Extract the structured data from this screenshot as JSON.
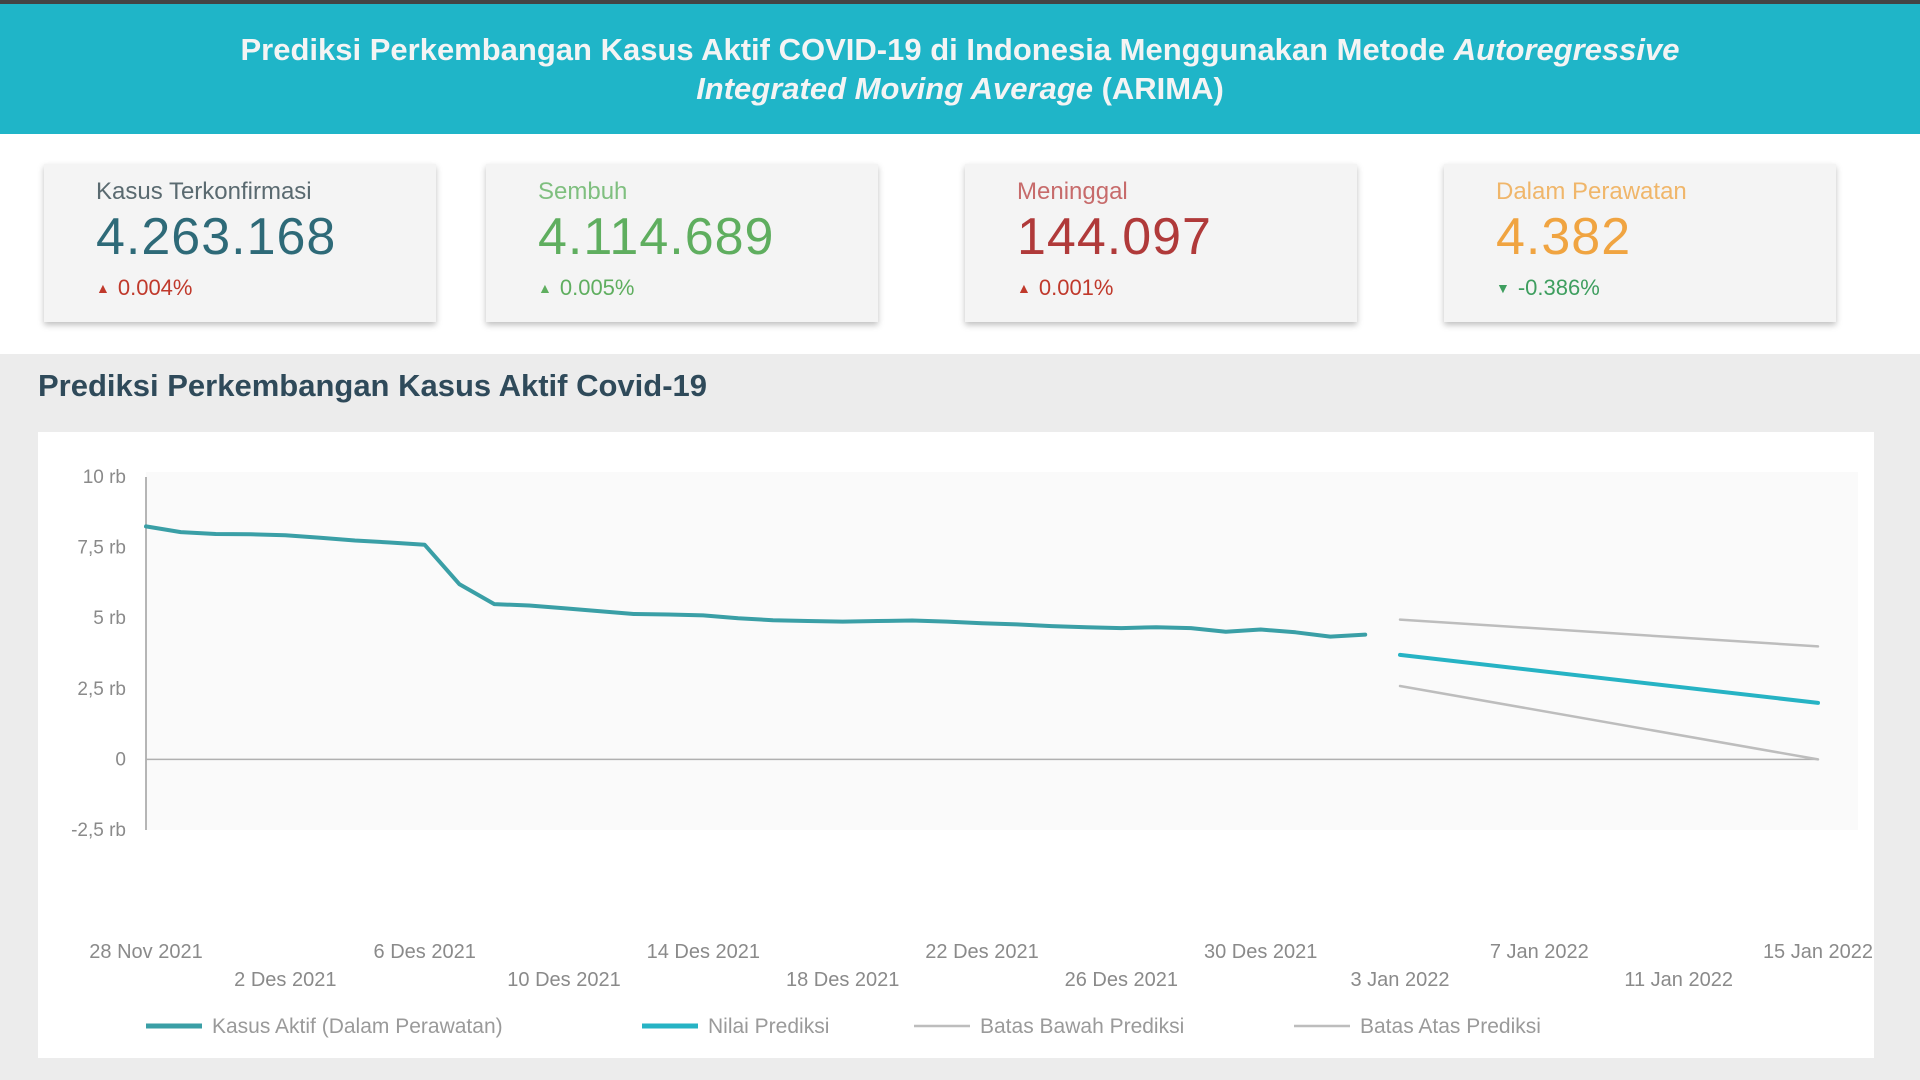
{
  "header": {
    "title_normal": "Prediksi Perkembangan Kasus Aktif COVID-19 di Indonesia Menggunakan Metode ",
    "title_italic_1": "Autoregressive",
    "title_italic_2": "Integrated Moving Average",
    "title_suffix": " (ARIMA)"
  },
  "cards": [
    {
      "label": "Kasus Terkonfirmasi",
      "value": "4.263.168",
      "change": "0.004%",
      "direction": "up",
      "label_color": "#5a6a70",
      "value_color": "#2e6a78",
      "change_color": "#c0392b",
      "arrow_color": "#c0392b"
    },
    {
      "label": "Sembuh",
      "value": "4.114.689",
      "change": "0.005%",
      "direction": "up",
      "label_color": "#7fbf7f",
      "value_color": "#5fae5f",
      "change_color": "#5fae5f",
      "arrow_color": "#5fae5f"
    },
    {
      "label": "Meninggal",
      "value": "144.097",
      "change": "0.001%",
      "direction": "up",
      "label_color": "#c76b6b",
      "value_color": "#b03a3a",
      "change_color": "#c0392b",
      "arrow_color": "#c0392b"
    },
    {
      "label": "Dalam Perawatan",
      "value": "4.382",
      "change": "-0.386%",
      "direction": "down",
      "label_color": "#f0b66a",
      "value_color": "#f0a441",
      "change_color": "#3e9e5f",
      "arrow_color": "#3e9e5f"
    }
  ],
  "section": {
    "title": "Prediksi Perkembangan Kasus Aktif Covid-19"
  },
  "chart_data": {
    "type": "line",
    "y_ticks": [
      "10 rb",
      "7,5 rb",
      "5 rb",
      "2,5 rb",
      "0",
      "-2,5 rb"
    ],
    "y_tick_values": [
      10000,
      7500,
      5000,
      2500,
      0,
      -2500
    ],
    "ylim": [
      -2500,
      10000
    ],
    "x_range": [
      "2021-11-28",
      "2022-01-15"
    ],
    "x_ticks_top": [
      {
        "label": "28 Nov 2021",
        "date": "2021-11-28"
      },
      {
        "label": "6 Des 2021",
        "date": "2021-12-06"
      },
      {
        "label": "14 Des 2021",
        "date": "2021-12-14"
      },
      {
        "label": "22 Des 2021",
        "date": "2021-12-22"
      },
      {
        "label": "30 Des 2021",
        "date": "2021-12-30"
      },
      {
        "label": "7 Jan 2022",
        "date": "2022-01-07"
      },
      {
        "label": "15 Jan 2022",
        "date": "2022-01-15"
      }
    ],
    "x_ticks_bottom": [
      {
        "label": "2 Des 2021",
        "date": "2021-12-02"
      },
      {
        "label": "10 Des 2021",
        "date": "2021-12-10"
      },
      {
        "label": "18 Des 2021",
        "date": "2021-12-18"
      },
      {
        "label": "26 Des 2021",
        "date": "2021-12-26"
      },
      {
        "label": "3 Jan 2022",
        "date": "2022-01-03"
      },
      {
        "label": "11 Jan 2022",
        "date": "2022-01-11"
      }
    ],
    "grid": false,
    "legend_position": "bottom",
    "series": [
      {
        "name": "Kasus Aktif (Dalam Perawatan)",
        "color": "#3a9fa6",
        "points": [
          [
            "2021-11-28",
            8250
          ],
          [
            "2021-11-29",
            8050
          ],
          [
            "2021-11-30",
            7980
          ],
          [
            "2021-12-01",
            7970
          ],
          [
            "2021-12-02",
            7940
          ],
          [
            "2021-12-03",
            7850
          ],
          [
            "2021-12-04",
            7750
          ],
          [
            "2021-12-05",
            7680
          ],
          [
            "2021-12-06",
            7600
          ],
          [
            "2021-12-07",
            6200
          ],
          [
            "2021-12-08",
            5500
          ],
          [
            "2021-12-09",
            5450
          ],
          [
            "2021-12-10",
            5350
          ],
          [
            "2021-12-11",
            5250
          ],
          [
            "2021-12-12",
            5150
          ],
          [
            "2021-12-13",
            5130
          ],
          [
            "2021-12-14",
            5100
          ],
          [
            "2021-12-15",
            5000
          ],
          [
            "2021-12-16",
            4930
          ],
          [
            "2021-12-17",
            4900
          ],
          [
            "2021-12-18",
            4880
          ],
          [
            "2021-12-19",
            4900
          ],
          [
            "2021-12-20",
            4920
          ],
          [
            "2021-12-21",
            4880
          ],
          [
            "2021-12-22",
            4820
          ],
          [
            "2021-12-23",
            4780
          ],
          [
            "2021-12-24",
            4720
          ],
          [
            "2021-12-25",
            4680
          ],
          [
            "2021-12-26",
            4650
          ],
          [
            "2021-12-27",
            4680
          ],
          [
            "2021-12-28",
            4650
          ],
          [
            "2021-12-29",
            4520
          ],
          [
            "2021-12-30",
            4600
          ],
          [
            "2021-12-31",
            4500
          ],
          [
            "2022-01-01",
            4350
          ],
          [
            "2022-01-02",
            4420
          ]
        ]
      },
      {
        "name": "Nilai Prediksi",
        "color": "#26b3c4",
        "points": [
          [
            "2022-01-03",
            3700
          ],
          [
            "2022-01-15",
            2000
          ]
        ]
      },
      {
        "name": "Batas Bawah Prediksi",
        "color": "#bdbdbd",
        "points": [
          [
            "2022-01-03",
            2600
          ],
          [
            "2022-01-15",
            0
          ]
        ]
      },
      {
        "name": "Batas Atas Prediksi",
        "color": "#bdbdbd",
        "points": [
          [
            "2022-01-03",
            4950
          ],
          [
            "2022-01-15",
            4000
          ]
        ]
      }
    ]
  }
}
